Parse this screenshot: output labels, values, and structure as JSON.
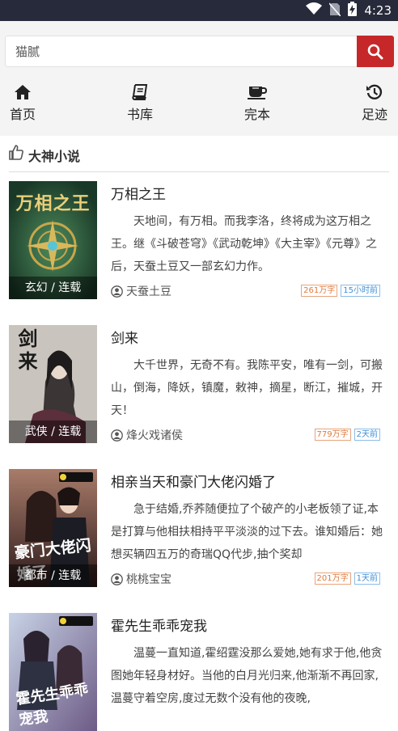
{
  "status_bar": {
    "time": "4:23"
  },
  "search": {
    "value": "猫腻"
  },
  "nav": [
    {
      "label": "首页",
      "icon": "home-icon"
    },
    {
      "label": "书库",
      "icon": "book-icon"
    },
    {
      "label": "完本",
      "icon": "coffee-cup-icon"
    },
    {
      "label": "足迹",
      "icon": "history-icon"
    }
  ],
  "section": {
    "title": "大神小说",
    "icon": "thumbs-up-icon"
  },
  "books": [
    {
      "title": "万相之王",
      "tag": "玄幻 / 连载",
      "desc": "天地间，有万相。而我李洛，终将成为这万相之王。继《斗破苍穹》《武动乾坤》《大主宰》《元尊》之后，天蚕土豆又一部玄幻力作。",
      "author": "天蚕土豆",
      "words": "261万字",
      "updated": "15小时前",
      "cover_title": "万相之王",
      "cover_color": "#2b5e3c"
    },
    {
      "title": "剑来",
      "tag": "武侠 / 连载",
      "desc": "大千世界，无奇不有。我陈平安，唯有一剑，可搬山，倒海，降妖，镇魔，敕神，摘星，断江，摧城，开天！",
      "author": "烽火戏诸侯",
      "words": "779万字",
      "updated": "2天前",
      "cover_title": "剑来",
      "cover_color": "#c9c4bd"
    },
    {
      "title": "相亲当天和豪门大佬闪婚了",
      "tag": "都市 / 连载",
      "desc": "急于结婚,乔荞随便拉了个破产的小老板领了证,本是打算与他相扶相持平平淡淡的过下去。谁知婚后：她想买辆四五万的奇瑞QQ代步,抽个奖却",
      "author": "桃桃宝宝",
      "words": "201万字",
      "updated": "1天前",
      "cover_title": "豪门大佬闪婚了",
      "cover_color": "#5a3a36"
    },
    {
      "title": "霍先生乖乖宠我",
      "tag": "",
      "desc": "温蔓一直知道,霍绍霆没那么爱她,她有求于他,他贪图她年轻身材好。当他的白月光归来,他渐渐不再回家,温蔓守着空房,度过无数个没有他的夜晚,",
      "author": "",
      "words": "",
      "updated": "",
      "cover_title": "霍先生乖乖宠我",
      "cover_color": "#8a9bb8"
    }
  ]
}
